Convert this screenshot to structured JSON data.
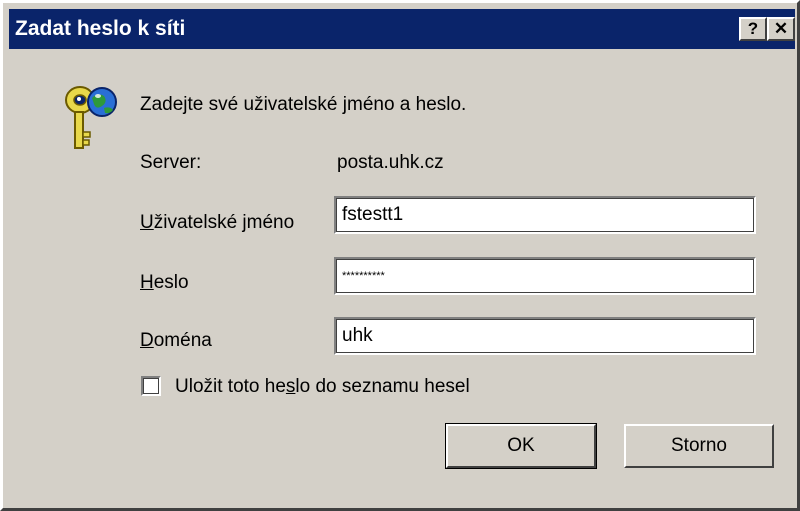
{
  "window": {
    "title": "Zadat heslo k síti",
    "help_button": "?",
    "close_button": "✕"
  },
  "dialog": {
    "prompt": "Zadejte své uživatelské jméno a heslo.",
    "server_label": "Server:",
    "server_value": "posta.uhk.cz",
    "username_label_hotkey": "U",
    "username_label_rest": "živatelské jméno",
    "username_value": "fstestt1",
    "password_label_hotkey": "H",
    "password_label_rest": "eslo",
    "password_value": "**********",
    "domain_label_hotkey": "D",
    "domain_label_rest": "oména",
    "domain_value": "uhk",
    "save_password_pre": "Uložit toto he",
    "save_password_hotkey": "s",
    "save_password_post": "lo do seznamu hesel",
    "save_password_checked": false,
    "ok_label": "OK",
    "cancel_label": "Storno"
  },
  "icons": {
    "prompt_icon": "keys-and-globe-icon"
  }
}
